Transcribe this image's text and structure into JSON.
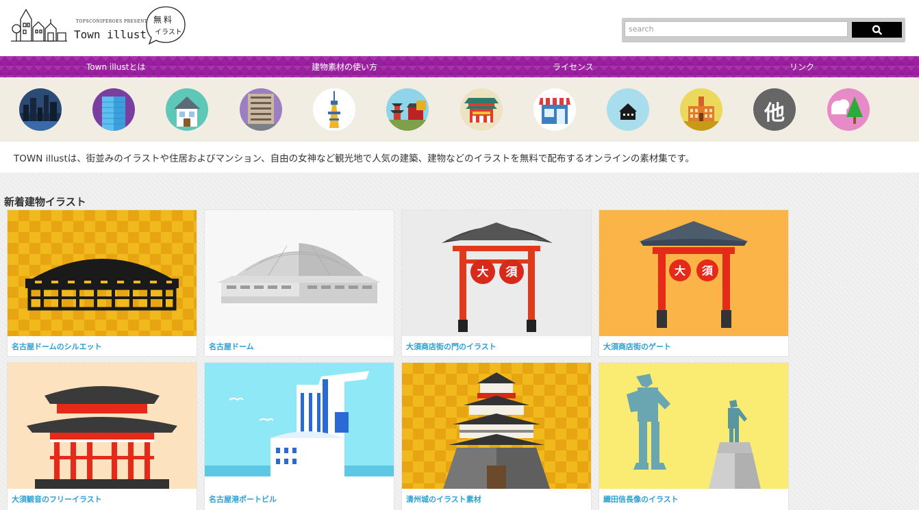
{
  "header": {
    "logo_presents": "TOPSCONIFEROES PRESENTS",
    "logo_name": "Town illust",
    "badge_line1": "無料",
    "badge_line2": "イラスト",
    "search_placeholder": "search",
    "search_icon": "search-icon"
  },
  "nav": {
    "items": [
      {
        "label": "Town illustとは"
      },
      {
        "label": "建物素材の使い方"
      },
      {
        "label": "ライセンス"
      },
      {
        "label": "リンク"
      }
    ]
  },
  "categories": [
    {
      "icon": "city-skyline-icon"
    },
    {
      "icon": "office-building-icon"
    },
    {
      "icon": "house-icon"
    },
    {
      "icon": "apartment-icon"
    },
    {
      "icon": "tower-icon"
    },
    {
      "icon": "pagoda-sightseeing-icon"
    },
    {
      "icon": "shrine-icon"
    },
    {
      "icon": "shop-icon"
    },
    {
      "icon": "small-house-icon"
    },
    {
      "icon": "school-icon"
    },
    {
      "icon": "other-icon",
      "label": "他"
    },
    {
      "icon": "nature-icon"
    }
  ],
  "description": "TOWN illustは、街並みのイラストや住居およびマンション、自由の女神など観光地で人気の建築、建物などのイラストを無料で配布するオンラインの素材集です。",
  "main": {
    "section_title": "新着建物イラスト",
    "cards": [
      {
        "title": "名古屋ドームのシルエット"
      },
      {
        "title": "名古屋ドーム"
      },
      {
        "title": "大須商店街の門のイラスト",
        "sign_left": "大",
        "sign_right": "須"
      },
      {
        "title": "大須商店街のゲート",
        "sign_left": "大",
        "sign_right": "須"
      },
      {
        "title": "大須観音のフリーイラスト"
      },
      {
        "title": "名古屋港ポートビル"
      },
      {
        "title": "清州城のイラスト素材"
      },
      {
        "title": "織田信長像のイラスト"
      }
    ]
  },
  "colors": {
    "nav_purple": "#9b1fa0",
    "category_bg": "#f2ede2",
    "link_blue": "#2aa0d5",
    "checker_gold": "#e8a512",
    "checker_light": "#f2b91c"
  }
}
